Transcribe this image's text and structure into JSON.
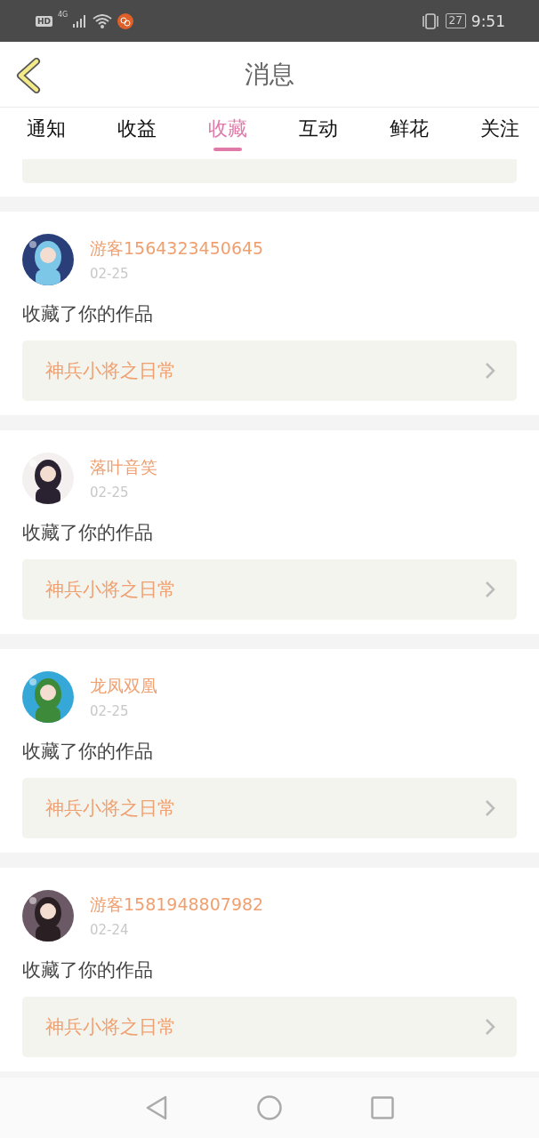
{
  "status_bar": {
    "hd": "HD",
    "network": "4G",
    "battery": "27",
    "time": "9:51"
  },
  "header": {
    "title": "消息"
  },
  "tabs": [
    {
      "label": "通知",
      "selected": false
    },
    {
      "label": "收益",
      "selected": false
    },
    {
      "label": "收藏",
      "selected": true
    },
    {
      "label": "互动",
      "selected": false
    },
    {
      "label": "鲜花",
      "selected": false
    },
    {
      "label": "关注",
      "selected": false
    }
  ],
  "messages": [
    {
      "user": "游客1564323450645",
      "date": "02-25",
      "text": "收藏了你的作品",
      "work": "神兵小将之日常"
    },
    {
      "user": "落叶音笑",
      "date": "02-25",
      "text": "收藏了你的作品",
      "work": "神兵小将之日常"
    },
    {
      "user": "龙凤双凰",
      "date": "02-25",
      "text": "收藏了你的作品",
      "work": "神兵小将之日常"
    },
    {
      "user": "游客1581948807982",
      "date": "02-24",
      "text": "收藏了你的作品",
      "work": "神兵小将之日常"
    }
  ]
}
